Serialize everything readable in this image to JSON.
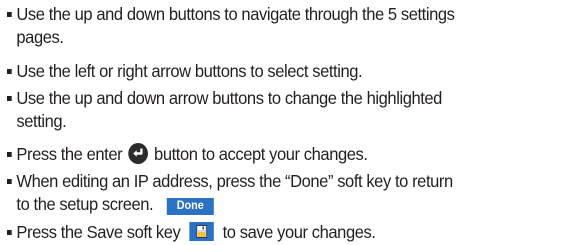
{
  "instructions": [
    {
      "lines": [
        "Use the up and down buttons to navigate through the 5 settings",
        "pages."
      ]
    },
    {
      "lines": [
        "Use the left or right arrow buttons to select setting."
      ]
    },
    {
      "lines": [
        "Use the up and down arrow buttons to change the highlighted",
        "setting."
      ]
    },
    {
      "before": "Press the enter ",
      "icon": "enter-icon",
      "after": " button to accept your changes."
    },
    {
      "lines": [
        "When editing an IP address, press the “Done” soft key to return",
        "to the setup screen."
      ],
      "softkey": {
        "label": "Done",
        "color": "#2b72c4"
      }
    },
    {
      "before": "Press the Save soft key ",
      "icon": "floppy-disk-icon",
      "after": " to save your changes."
    }
  ],
  "colors": {
    "text": "#231f20",
    "softkey": "#2b72c4"
  }
}
